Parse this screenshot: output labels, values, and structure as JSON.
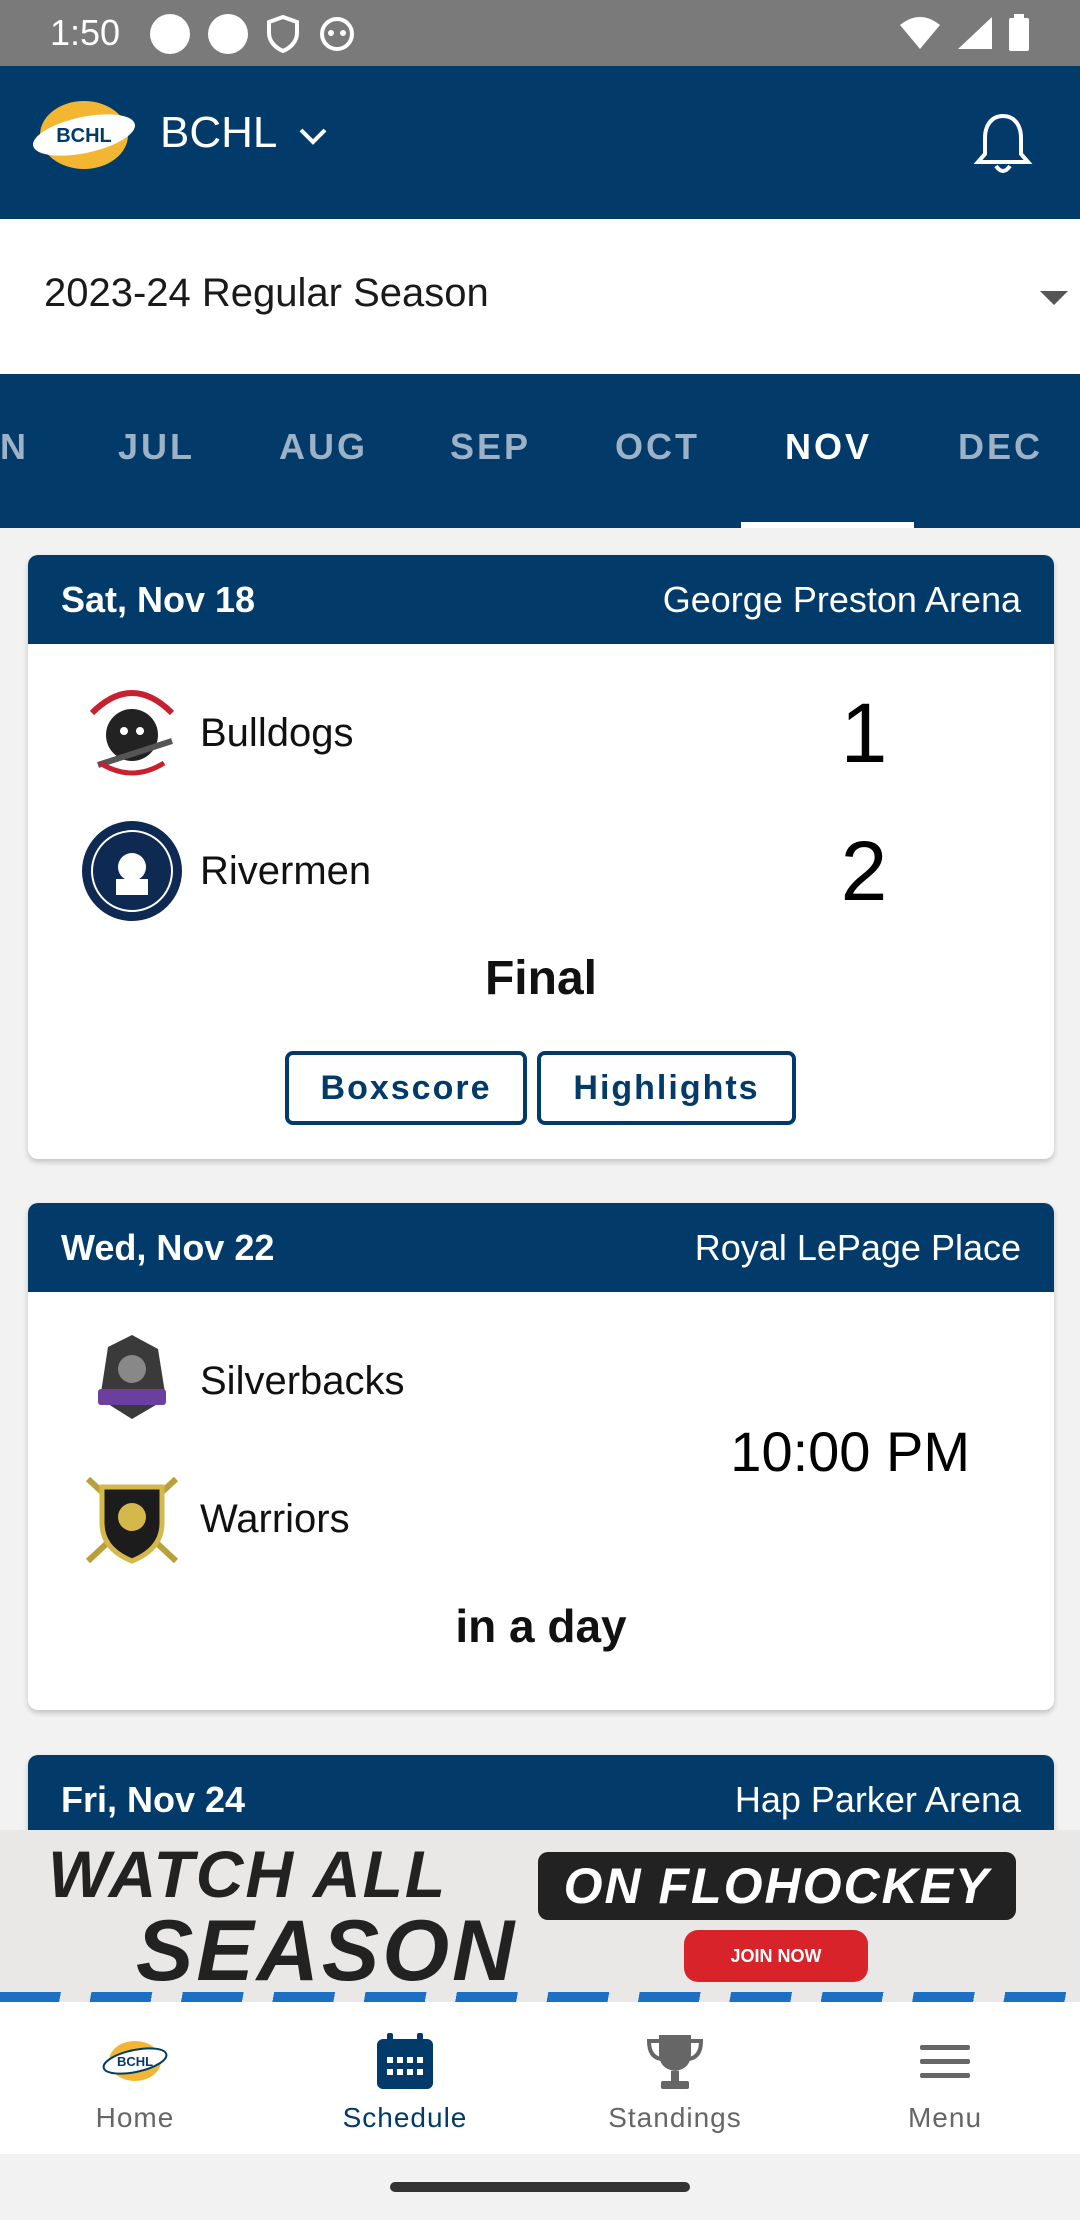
{
  "status_bar": {
    "time": "1:50"
  },
  "app_bar": {
    "title": "BCHL",
    "logo_text": "BCHL"
  },
  "season_select": {
    "value": "2023-24 Regular Season"
  },
  "months": [
    "N",
    "JUL",
    "AUG",
    "SEP",
    "OCT",
    "NOV",
    "DEC"
  ],
  "active_month": "NOV",
  "games": [
    {
      "date": "Sat, Nov 18",
      "venue": "George Preston Arena",
      "home": {
        "name": "Bulldogs",
        "score": "1"
      },
      "away": {
        "name": "Rivermen",
        "score": "2"
      },
      "status": "Final",
      "buttons": {
        "boxscore": "Boxscore",
        "highlights": "Highlights"
      }
    },
    {
      "date": "Wed, Nov 22",
      "venue": "Royal LePage Place",
      "home": {
        "name": "Silverbacks"
      },
      "away": {
        "name": "Warriors"
      },
      "time": "10:00 PM",
      "status": "in a day"
    },
    {
      "date": "Fri, Nov 24",
      "venue": "Hap Parker Arena"
    }
  ],
  "ad": {
    "line1": "WATCH ALL",
    "line2": "SEASON",
    "brand": "ON FLOHOCKEY",
    "cta": "JOIN NOW"
  },
  "bottom_nav": [
    {
      "label": "Home",
      "icon": "bchl-logo-icon"
    },
    {
      "label": "Schedule",
      "icon": "calendar-icon"
    },
    {
      "label": "Standings",
      "icon": "trophy-icon"
    },
    {
      "label": "Menu",
      "icon": "hamburger-menu-icon"
    }
  ],
  "colors": {
    "primary": "#023b6a",
    "accent_red": "#d8232a"
  }
}
